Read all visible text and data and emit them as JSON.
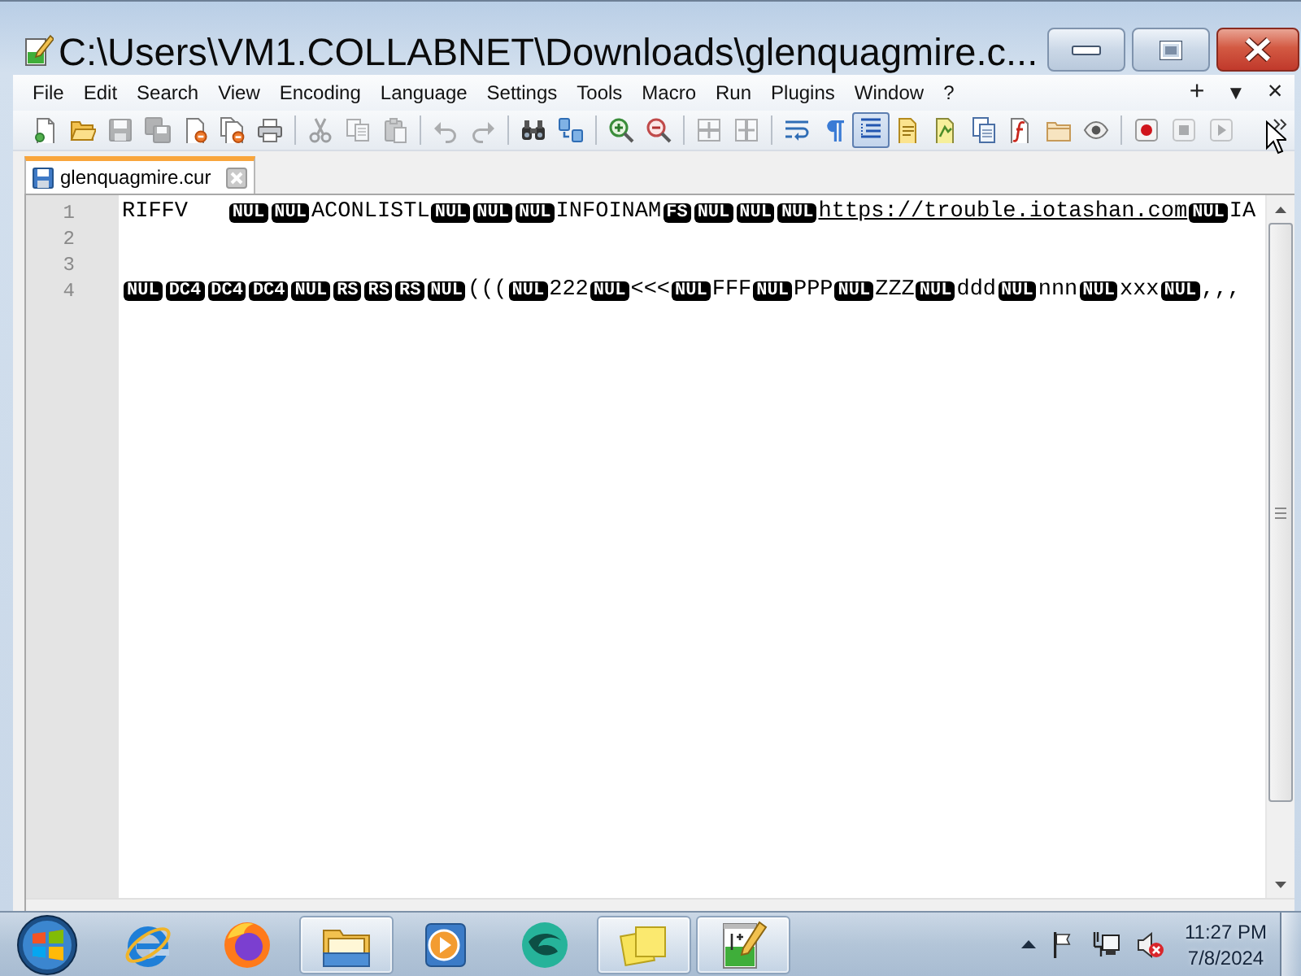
{
  "window": {
    "title": "C:\\Users\\VM1.COLLABNET\\Downloads\\glenquagmire.c..."
  },
  "menu_bar": {
    "items": [
      "File",
      "Edit",
      "Search",
      "View",
      "Encoding",
      "Language",
      "Settings",
      "Tools",
      "Macro",
      "Run",
      "Plugins",
      "Window",
      "?"
    ],
    "right_controls": [
      {
        "kind": "add",
        "label": "+"
      },
      {
        "kind": "list",
        "label": "▼"
      },
      {
        "kind": "close",
        "label": "×"
      }
    ]
  },
  "toolbar": {
    "groups": [
      [
        {
          "kind": "new",
          "disabled": false,
          "pressed": false
        },
        {
          "kind": "open",
          "disabled": false,
          "pressed": false
        },
        {
          "kind": "save",
          "disabled": true,
          "pressed": false
        },
        {
          "kind": "save-all",
          "disabled": true,
          "pressed": false
        },
        {
          "kind": "close",
          "disabled": false,
          "pressed": false
        },
        {
          "kind": "close-all",
          "disabled": false,
          "pressed": false
        },
        {
          "kind": "print",
          "disabled": false,
          "pressed": false
        }
      ],
      [
        {
          "kind": "cut",
          "disabled": true,
          "pressed": false
        },
        {
          "kind": "copy",
          "disabled": true,
          "pressed": false
        },
        {
          "kind": "paste",
          "disabled": true,
          "pressed": false
        }
      ],
      [
        {
          "kind": "undo",
          "disabled": true,
          "pressed": false
        },
        {
          "kind": "redo",
          "disabled": true,
          "pressed": false
        }
      ],
      [
        {
          "kind": "find",
          "disabled": false,
          "pressed": false
        },
        {
          "kind": "replace",
          "disabled": false,
          "pressed": false
        }
      ],
      [
        {
          "kind": "zoom-in",
          "disabled": false,
          "pressed": false
        },
        {
          "kind": "zoom-out",
          "disabled": false,
          "pressed": false
        }
      ],
      [
        {
          "kind": "sync-v",
          "disabled": true,
          "pressed": false
        },
        {
          "kind": "sync-h",
          "disabled": true,
          "pressed": false
        }
      ],
      [
        {
          "kind": "wrap",
          "disabled": false,
          "pressed": false
        },
        {
          "kind": "all-chars",
          "disabled": false,
          "pressed": false
        },
        {
          "kind": "indent-guide",
          "disabled": false,
          "pressed": true
        },
        {
          "kind": "udl",
          "disabled": false,
          "pressed": false
        },
        {
          "kind": "doc-map",
          "disabled": false,
          "pressed": false
        },
        {
          "kind": "doc-list",
          "disabled": false,
          "pressed": false
        },
        {
          "kind": "function-list",
          "disabled": false,
          "pressed": false
        },
        {
          "kind": "folder",
          "disabled": false,
          "pressed": false
        },
        {
          "kind": "monitoring",
          "disabled": false,
          "pressed": false
        }
      ],
      [
        {
          "kind": "record",
          "disabled": false,
          "pressed": false
        },
        {
          "kind": "stop",
          "disabled": true,
          "pressed": false
        },
        {
          "kind": "play",
          "disabled": true,
          "pressed": false
        }
      ]
    ]
  },
  "tabs": [
    {
      "label": "glenquagmire.cur",
      "selected": true
    }
  ],
  "editor": {
    "lines": [
      {
        "number": "1",
        "segments": [
          {
            "kind": "text",
            "text": "RIFFV"
          },
          {
            "kind": "tab"
          },
          {
            "kind": "control",
            "text": "NUL"
          },
          {
            "kind": "control",
            "text": "NUL"
          },
          {
            "kind": "text",
            "text": "ACONLISTL"
          },
          {
            "kind": "control",
            "text": "NUL"
          },
          {
            "kind": "control",
            "text": "NUL"
          },
          {
            "kind": "control",
            "text": "NUL"
          },
          {
            "kind": "text",
            "text": "INFOINAM"
          },
          {
            "kind": "control",
            "text": "FS"
          },
          {
            "kind": "control",
            "text": "NUL"
          },
          {
            "kind": "control",
            "text": "NUL"
          },
          {
            "kind": "control",
            "text": "NUL"
          },
          {
            "kind": "link",
            "text": "https://trouble.iotashan.com"
          },
          {
            "kind": "control",
            "text": "NUL"
          },
          {
            "kind": "text",
            "text": "IA"
          }
        ]
      },
      {
        "number": "2"
      },
      {
        "number": "3"
      },
      {
        "number": "4",
        "segments": [
          {
            "kind": "control",
            "text": "NUL"
          },
          {
            "kind": "control",
            "text": "DC4"
          },
          {
            "kind": "control",
            "text": "DC4"
          },
          {
            "kind": "control",
            "text": "DC4"
          },
          {
            "kind": "control",
            "text": "NUL"
          },
          {
            "kind": "control",
            "text": "RS"
          },
          {
            "kind": "control",
            "text": "RS"
          },
          {
            "kind": "control",
            "text": "RS"
          },
          {
            "kind": "control",
            "text": "NUL"
          },
          {
            "kind": "text",
            "text": "((("
          },
          {
            "kind": "control",
            "text": "NUL"
          },
          {
            "kind": "text",
            "text": "222"
          },
          {
            "kind": "control",
            "text": "NUL"
          },
          {
            "kind": "text",
            "text": "<<<"
          },
          {
            "kind": "control",
            "text": "NUL"
          },
          {
            "kind": "text",
            "text": "FFF"
          },
          {
            "kind": "control",
            "text": "NUL"
          },
          {
            "kind": "text",
            "text": "PPP"
          },
          {
            "kind": "control",
            "text": "NUL"
          },
          {
            "kind": "text",
            "text": "ZZZ"
          },
          {
            "kind": "control",
            "text": "NUL"
          },
          {
            "kind": "text",
            "text": "ddd"
          },
          {
            "kind": "control",
            "text": "NUL"
          },
          {
            "kind": "text",
            "text": "nnn"
          },
          {
            "kind": "control",
            "text": "NUL"
          },
          {
            "kind": "text",
            "text": "xxx"
          },
          {
            "kind": "control",
            "text": "NUL"
          },
          {
            "kind": "text",
            "text": ",,,"
          }
        ]
      }
    ]
  },
  "taskbar": {
    "apps": [
      {
        "kind": "ie",
        "running": false
      },
      {
        "kind": "firefox",
        "running": false
      },
      {
        "kind": "explorer",
        "running": true
      },
      {
        "kind": "media",
        "running": false
      },
      {
        "kind": "sphere",
        "running": false
      },
      {
        "kind": "notes",
        "running": true
      },
      {
        "kind": "notepad",
        "running": true
      }
    ],
    "tray": [
      {
        "kind": "show-hidden"
      },
      {
        "kind": "flag"
      },
      {
        "kind": "network"
      },
      {
        "kind": "volume",
        "muted": true
      }
    ],
    "clock": {
      "time": "11:27 PM",
      "date": "7/8/2024"
    }
  }
}
